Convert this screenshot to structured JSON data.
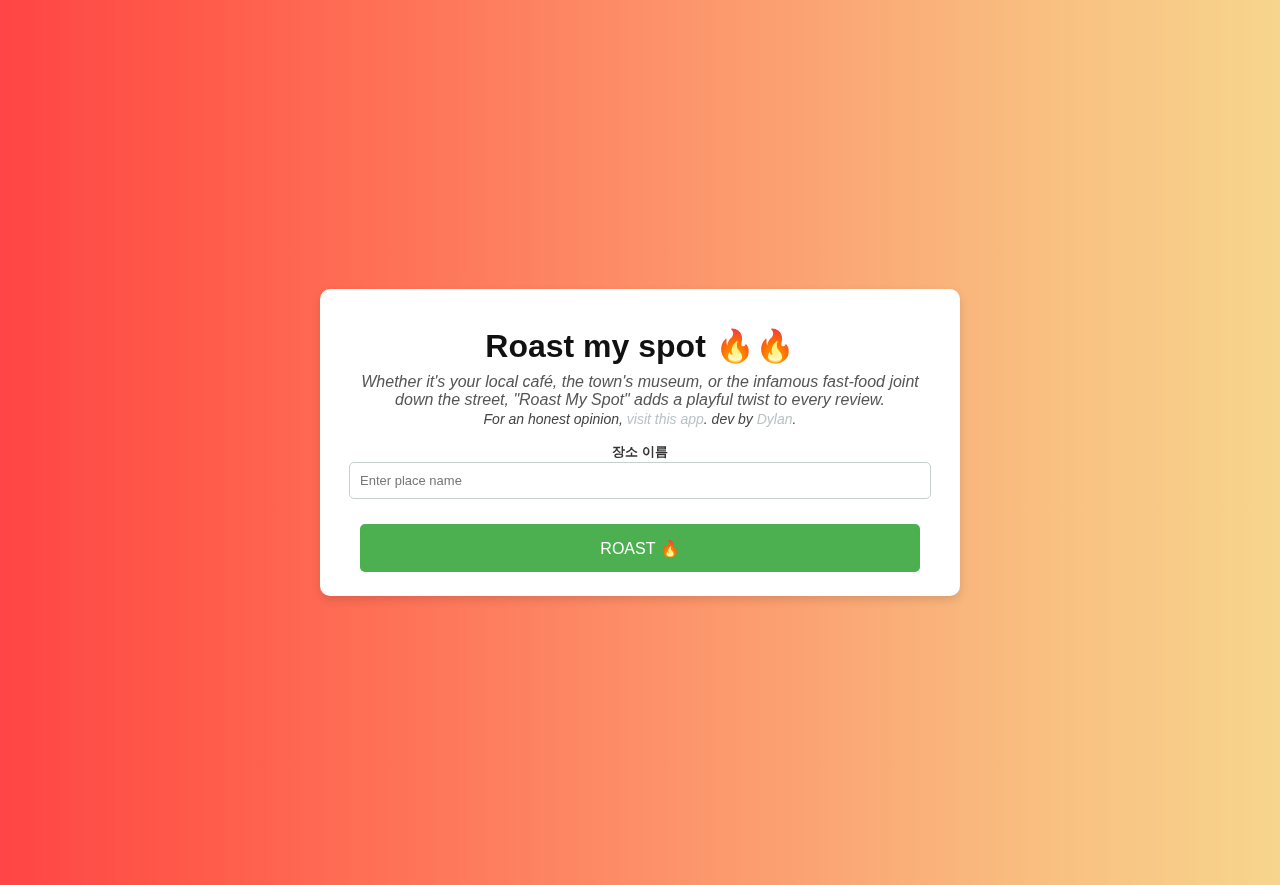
{
  "title": "Roast my spot 🔥🔥",
  "description": "Whether it's your local café, the town's museum, or the infamous fast-food joint down the street, \"Roast My Spot\" adds a playful twist to every review.",
  "credit": {
    "parts": [
      {
        "kind": "text",
        "text": "For an honest opinion, "
      },
      {
        "kind": "link",
        "text": "visit this app"
      },
      {
        "kind": "text",
        "text": ". dev by "
      },
      {
        "kind": "link",
        "text": "Dylan"
      },
      {
        "kind": "text",
        "text": "."
      }
    ]
  },
  "field": {
    "label": "장소 이름",
    "placeholder": "Enter place name"
  },
  "button": {
    "label": "ROAST 🔥"
  }
}
